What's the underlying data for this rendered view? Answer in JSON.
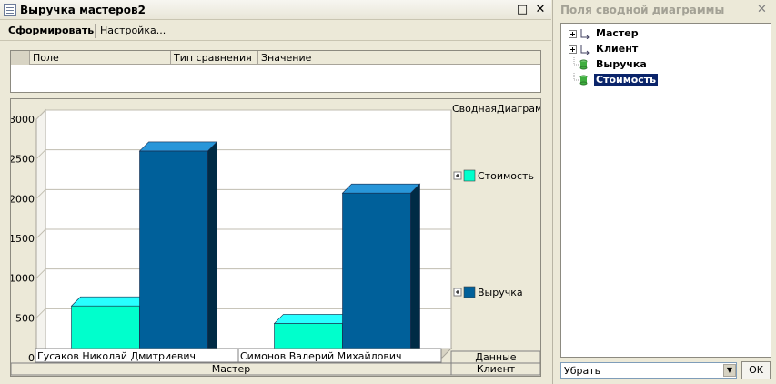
{
  "main_window": {
    "title": "Выручка мастеров2",
    "minimize_glyph": "_",
    "maximize_glyph": "□",
    "close_glyph": "✕"
  },
  "toolbar": {
    "generate_label": "Сформировать",
    "settings_label": "Настройка..."
  },
  "filter_table": {
    "columns": [
      "Поле",
      "Тип сравнения",
      "Значение"
    ]
  },
  "chart_data": {
    "type": "bar",
    "title": "СводнаяДиаграм...",
    "categories": [
      "Гусаков Николай Дмитриевич",
      "Симонов Валерий Михайлович"
    ],
    "series": [
      {
        "name": "Стоимость",
        "values": [
          650,
          430
        ],
        "color": "#00ffcc"
      },
      {
        "name": "Выручка",
        "values": [
          2600,
          2070
        ],
        "color": "#00609a"
      }
    ],
    "ylim": [
      0,
      3000
    ],
    "yticks": [
      0,
      500,
      1000,
      1500,
      2000,
      2500,
      3000
    ],
    "grid": true,
    "legend_position": "right",
    "field_row_label": "Мастер",
    "data_field_label": "Данные",
    "series_field_label": "Клиент"
  },
  "side_panel": {
    "title": "Поля сводной диаграммы",
    "close_glyph": "✕",
    "tree": [
      {
        "label": "Мастер",
        "kind": "dimension",
        "expandable": true,
        "selected": false
      },
      {
        "label": "Клиент",
        "kind": "dimension",
        "expandable": true,
        "selected": false
      },
      {
        "label": "Выручка",
        "kind": "resource",
        "expandable": false,
        "selected": false
      },
      {
        "label": "Стоимость",
        "kind": "resource",
        "expandable": false,
        "selected": true
      }
    ],
    "select_value": "Убрать",
    "ok_label": "OK"
  }
}
